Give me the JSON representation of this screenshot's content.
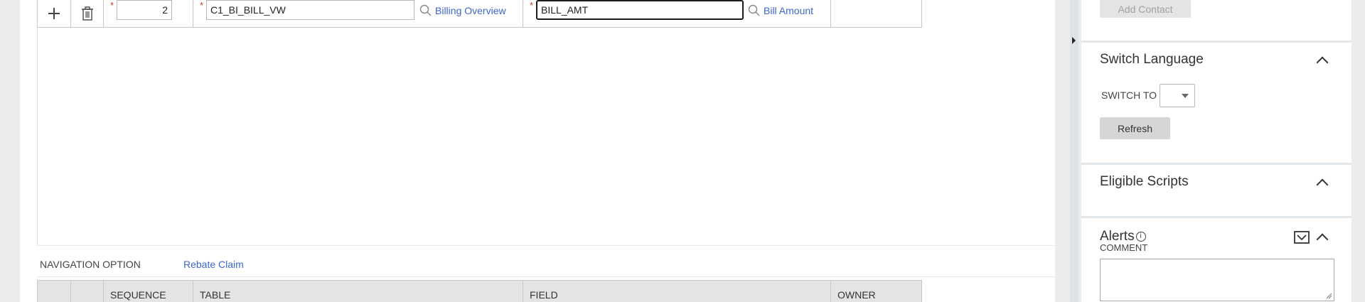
{
  "grid": {
    "row": {
      "sequence": "2",
      "table": "C1_BI_BILL_VW",
      "table_lookup": "Billing Overview",
      "field": "BILL_AMT",
      "field_lookup": "Bill Amount",
      "required_mark": "*"
    },
    "columns": [
      "SEQUENCE",
      "TABLE",
      "FIELD",
      "OWNER"
    ]
  },
  "navigation": {
    "label": "NAVIGATION OPTION",
    "value": "Rebate Claim"
  },
  "sidebar": {
    "add_contact": "Add Contact",
    "switch_language": {
      "title": "Switch Language",
      "switch_to_label": "SWITCH TO",
      "refresh": "Refresh"
    },
    "eligible_scripts": {
      "title": "Eligible Scripts"
    },
    "alerts": {
      "title": "Alerts",
      "comment_label": "COMMENT"
    }
  },
  "icons": {
    "add": "plus-icon",
    "delete": "trash-icon",
    "lookup": "search-icon",
    "collapse": "chevron-up-icon",
    "info": "info-icon",
    "filter": "filter-icon",
    "panel_toggle": "caret-right-icon"
  },
  "colors": {
    "link": "#3d65c7",
    "required": "#c0392b",
    "divider": "#dde3e8"
  }
}
